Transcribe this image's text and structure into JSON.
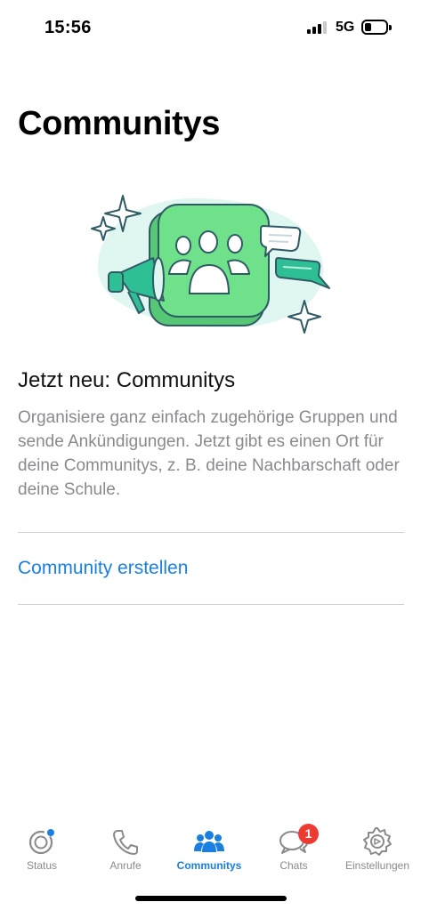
{
  "status_bar": {
    "time": "15:56",
    "network": "5G"
  },
  "page_title": "Communitys",
  "intro": {
    "heading": "Jetzt neu: Communitys",
    "description": "Organisiere ganz einfach zugehörige Gruppen und sende Ankündigungen. Jetzt gibt es einen Ort für deine Communitys, z. B. deine Nachbarschaft oder deine Schule."
  },
  "actions": {
    "create_community": "Community erstellen"
  },
  "tab_bar": {
    "tabs": [
      {
        "label": "Status",
        "icon": "status-icon"
      },
      {
        "label": "Anrufe",
        "icon": "phone-icon"
      },
      {
        "label": "Communitys",
        "icon": "communities-icon",
        "active": true
      },
      {
        "label": "Chats",
        "icon": "chat-bubbles-icon",
        "badge": "1"
      },
      {
        "label": "Einstellungen",
        "icon": "gear-icon"
      }
    ]
  },
  "colors": {
    "accent": "#1a7fe0",
    "badge": "#ee3b32",
    "illustration_green": "#6fe18a",
    "illustration_bg": "#dff6f1"
  }
}
